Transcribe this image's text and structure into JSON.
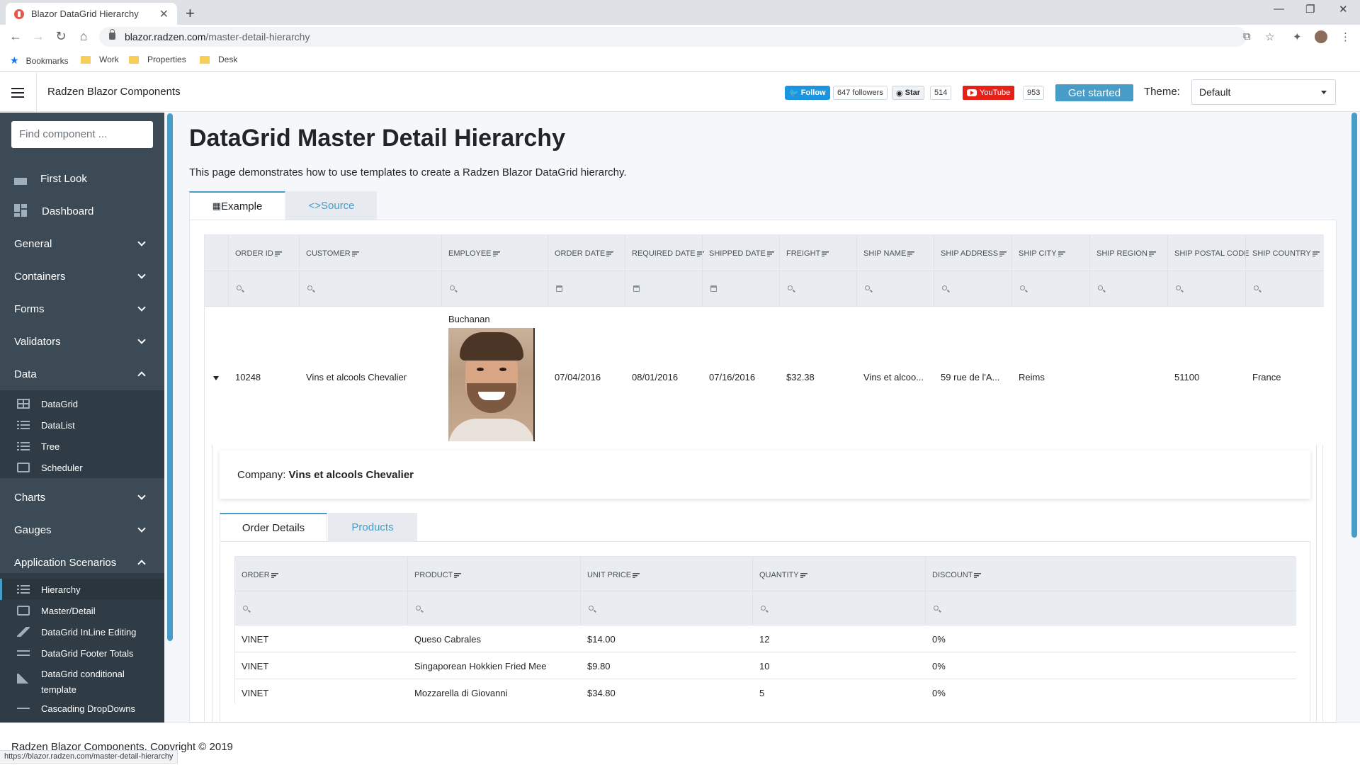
{
  "browser": {
    "tab_title": "Blazor DataGrid Hierarchy",
    "url_domain": "blazor.radzen.com",
    "url_path": "/master-detail-hierarchy",
    "bookmarks": [
      "Bookmarks",
      "Work",
      "Properties",
      "Desk"
    ],
    "status_url": "https://blazor.radzen.com/master-detail-hierarchy"
  },
  "header": {
    "title": "Radzen Blazor Components",
    "twitter_follow": "Follow",
    "twitter_followers": "647 followers",
    "github_star": "Star",
    "github_count": "514",
    "youtube": "YouTube",
    "youtube_count": "953",
    "get_started": "Get started",
    "theme_label": "Theme:",
    "theme_value": "Default"
  },
  "sidebar": {
    "search_placeholder": "Find component ...",
    "items": [
      "First Look",
      "Dashboard",
      "General",
      "Containers",
      "Forms",
      "Validators",
      "Data",
      "Charts",
      "Gauges",
      "Application Scenarios"
    ],
    "data_sub": [
      "DataGrid",
      "DataList",
      "Tree",
      "Scheduler"
    ],
    "scenario_sub": [
      "Hierarchy",
      "Master/Detail",
      "DataGrid InLine Editing",
      "DataGrid Footer Totals",
      "DataGrid conditional",
      "template",
      "Cascading DropDowns"
    ]
  },
  "page": {
    "title": "DataGrid Master Detail Hierarchy",
    "description": "This page demonstrates how to use templates to create a Radzen Blazor DataGrid hierarchy.",
    "tab_example": "Example",
    "tab_source": "Source"
  },
  "grid": {
    "columns": [
      "ORDER ID",
      "CUSTOMER",
      "EMPLOYEE",
      "ORDER DATE",
      "REQUIRED DATE",
      "SHIPPED DATE",
      "FREIGHT",
      "SHIP NAME",
      "SHIP ADDRESS",
      "SHIP CITY",
      "SHIP REGION",
      "SHIP POSTAL CODE",
      "SHIP COUNTRY"
    ],
    "row": {
      "order_id": "10248",
      "customer": "Vins et alcools Chevalier",
      "employee": "Buchanan",
      "order_date": "07/04/2016",
      "required_date": "08/01/2016",
      "shipped_date": "07/16/2016",
      "freight": "$32.38",
      "ship_name": "Vins et alcoo...",
      "ship_address": "59 rue de l'A...",
      "ship_city": "Reims",
      "ship_region": "",
      "ship_postal": "51100",
      "ship_country": "France"
    }
  },
  "detail": {
    "company_label": "Company:",
    "company_value": "Vins et alcools Chevalier",
    "tab_order_details": "Order Details",
    "tab_products": "Products",
    "columns": [
      "ORDER",
      "PRODUCT",
      "UNIT PRICE",
      "QUANTITY",
      "DISCOUNT"
    ],
    "rows": [
      [
        "VINET",
        "Queso Cabrales",
        "$14.00",
        "12",
        "0%"
      ],
      [
        "VINET",
        "Singaporean Hokkien Fried Mee",
        "$9.80",
        "10",
        "0%"
      ],
      [
        "VINET",
        "Mozzarella di Giovanni",
        "$34.80",
        "5",
        "0%"
      ]
    ]
  },
  "footer": {
    "copyright": "Radzen Blazor Components, Copyright © 2019"
  }
}
